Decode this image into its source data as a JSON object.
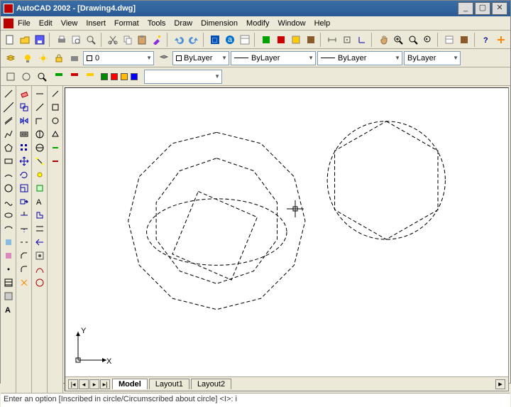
{
  "title": "AutoCAD 2002 - [Drawing4.dwg]",
  "menu": [
    "File",
    "Edit",
    "View",
    "Insert",
    "Format",
    "Tools",
    "Draw",
    "Dimension",
    "Modify",
    "Window",
    "Help"
  ],
  "layer_combo": "0",
  "prop_combos": [
    "ByLayer",
    "ByLayer",
    "ByLayer",
    "ByLayer"
  ],
  "tabs": {
    "active": "Model",
    "others": [
      "Layout1",
      "Layout2"
    ]
  },
  "ucs": {
    "x": "X",
    "y": "Y"
  },
  "cmd": "Enter an option [Inscribed in circle/Circumscribed about circle] <I>: i",
  "colors": {
    "accent": "#3a6ea5",
    "bg": "#ece9d8"
  },
  "icon_colors": {
    "new": "#fff",
    "open": "#ffcc33",
    "save": "#5a5aff",
    "print": "#888",
    "preview": "#aaa",
    "cut": "#999",
    "copy": "#ccc",
    "paste": "#d2a36c",
    "match": "#8a2be2",
    "undo": "#4a90d9",
    "redo": "#4a90d9",
    "blue": "#0050b8",
    "green": "#00a000",
    "red": "#c00",
    "yellow": "#ffcc00",
    "brown": "#8b5a2b",
    "pan": "#d9a96b",
    "zoom": "#000",
    "help": "#00a",
    "plus": "#f80"
  }
}
